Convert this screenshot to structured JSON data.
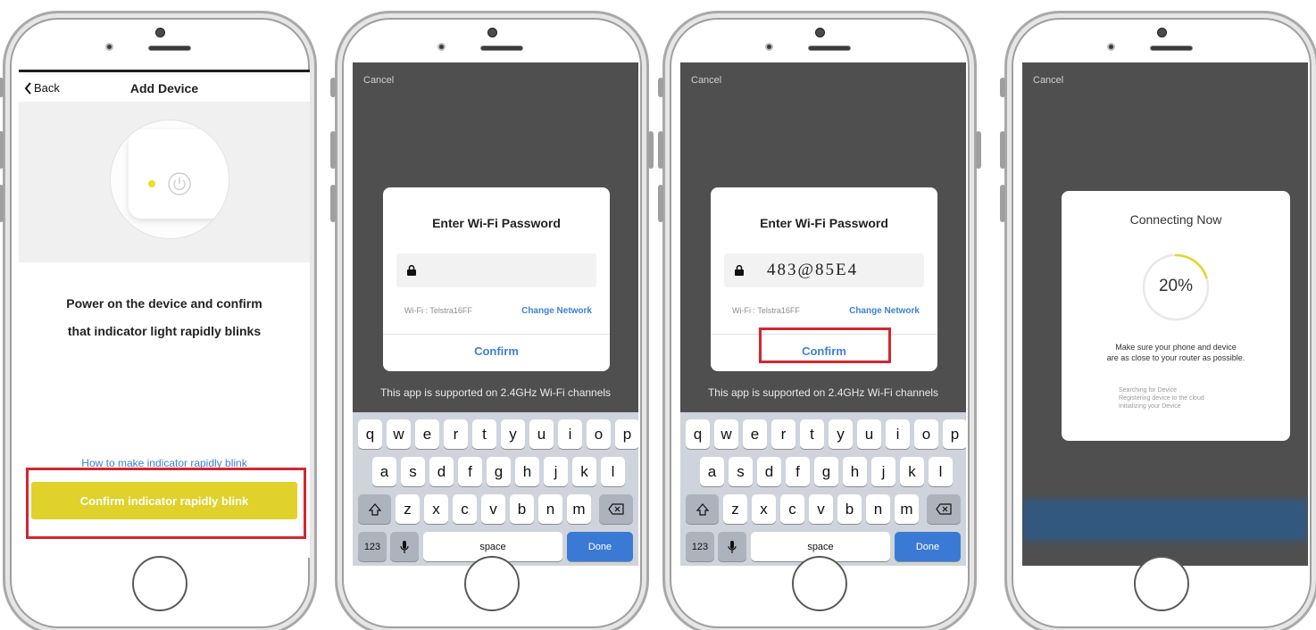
{
  "phone1": {
    "nav": {
      "back_label": "Back",
      "title": "Add Device"
    },
    "instruction_line1": "Power on the device and confirm",
    "instruction_line2": "that indicator light rapidly blinks",
    "help_link": "How to make indicator rapidly blink",
    "confirm_button": "Confirm indicator rapidly blink",
    "led_color": "#f2dd1f",
    "button_color": "#e0d12b",
    "highlight_color": "#d3262f"
  },
  "phone2": {
    "cancel": "Cancel",
    "dialog": {
      "title": "Enter Wi-Fi Password",
      "password_value": "",
      "wifi_label": "Wi-Fi : Telstra16FF",
      "change_network": "Change Network",
      "confirm": "Confirm"
    },
    "support_note": "This app is supported on 2.4GHz Wi-Fi channels"
  },
  "phone3": {
    "cancel": "Cancel",
    "dialog": {
      "title": "Enter Wi-Fi Password",
      "password_value": "483@85E4",
      "wifi_label": "Wi-Fi : Telstra16FF",
      "change_network": "Change Network",
      "confirm": "Confirm"
    },
    "support_note": "This app is supported on 2.4GHz Wi-Fi channels"
  },
  "keyboard": {
    "row1": [
      "q",
      "w",
      "e",
      "r",
      "t",
      "y",
      "u",
      "i",
      "o",
      "p"
    ],
    "row2": [
      "a",
      "s",
      "d",
      "f",
      "g",
      "h",
      "j",
      "k",
      "l"
    ],
    "row3": [
      "z",
      "x",
      "c",
      "v",
      "b",
      "n",
      "m"
    ],
    "numbers_key": "123",
    "space_key": "space",
    "done_key": "Done",
    "shift_icon": "shift-icon",
    "delete_icon": "backspace-icon",
    "mic_icon": "microphone-icon"
  },
  "phone4": {
    "cancel": "Cancel",
    "title": "Connecting Now",
    "progress_percent": 20,
    "progress_label": "20%",
    "message_line1": "Make sure your phone and device",
    "message_line2": "are as close to your router as possible.",
    "steps": [
      "Searching for Device",
      "Registering device to the cloud",
      "Initializing your Device"
    ],
    "progress_color": "#e6d42a"
  }
}
